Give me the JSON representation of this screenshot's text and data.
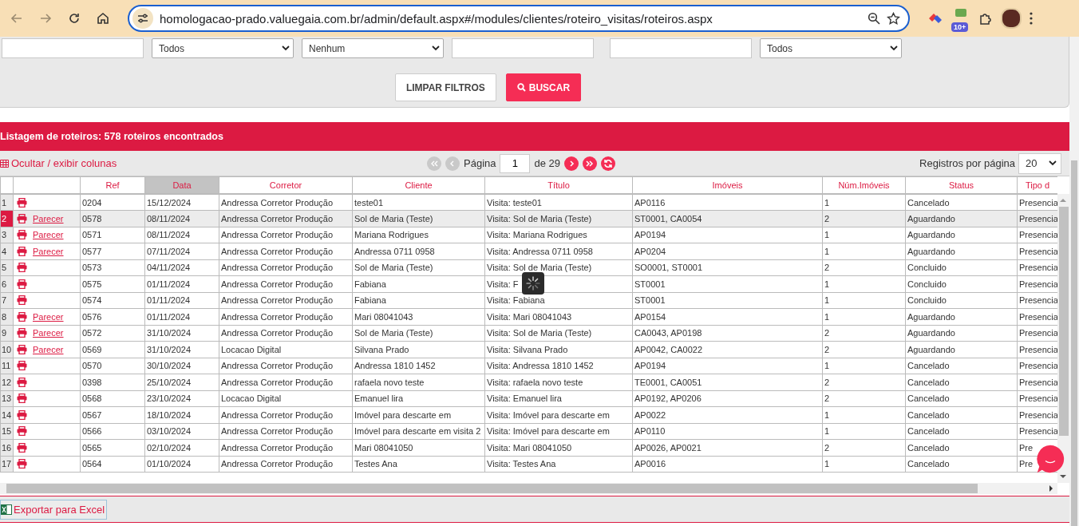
{
  "browser": {
    "url": "homologacao-prado.valuegaia.com.br/admin/default.aspx#/modules/clientes/roteiro_visitas/roteiros.aspx",
    "badge": "10+"
  },
  "filters": [
    {
      "kind": "input"
    },
    {
      "kind": "select",
      "value": "Todos"
    },
    {
      "kind": "select",
      "value": "Nenhum"
    },
    {
      "kind": "input"
    },
    {
      "kind": "input"
    },
    {
      "kind": "select",
      "value": "Todos"
    }
  ],
  "buttons": [
    {
      "kind": "secondary",
      "label": "LIMPAR FILTROS"
    },
    {
      "kind": "primary",
      "label": "BUSCAR"
    }
  ],
  "listing_title": "Listagem de roteiros: 578 roteiros encontrados",
  "toolbar": {
    "columns_toggle": "Ocultar / exibir colunas",
    "page_label": "Página",
    "page": "1",
    "page_total": "de 29",
    "per_page_label": "Registros por página",
    "per_page": "20"
  },
  "table": {
    "columns": [
      {
        "label": "Ref",
        "sorted": false
      },
      {
        "label": "Data",
        "sorted": true
      },
      {
        "label": "Corretor",
        "sorted": false
      },
      {
        "label": "Cliente",
        "sorted": false
      },
      {
        "label": "Título",
        "sorted": false
      },
      {
        "label": "Imóveis",
        "sorted": false
      },
      {
        "label": "Núm.Imóveis",
        "sorted": false
      },
      {
        "label": "Status",
        "sorted": false
      },
      {
        "label": "Tipo d",
        "sorted": false
      }
    ],
    "rows": [
      {
        "num": "1",
        "selected": false,
        "cells": [
          "0204",
          "15/12/2024",
          "Andressa Corretor Produção",
          "teste01",
          "Visita: teste01",
          "AP0116",
          "1",
          "Cancelado",
          "Presencia"
        ]
      },
      {
        "num": "2",
        "selected": true,
        "link": "Parecer",
        "cells": [
          "0578",
          "08/11/2024",
          "Andressa Corretor Produção",
          "Sol de Maria (Teste)",
          "Visita: Sol de Maria (Teste)",
          "ST0001, CA0054",
          "2",
          "Aguardando",
          "Presencia"
        ]
      },
      {
        "num": "3",
        "selected": false,
        "link": "Parecer",
        "cells": [
          "0571",
          "08/11/2024",
          "Andressa Corretor Produção",
          "Mariana Rodrigues",
          "Visita: Mariana Rodrigues",
          "AP0194",
          "1",
          "Aguardando",
          "Presencia"
        ]
      },
      {
        "num": "4",
        "selected": false,
        "link": "Parecer",
        "cells": [
          "0577",
          "07/11/2024",
          "Andressa Corretor Produção",
          "Andressa 0711 0958",
          "Visita: Andressa 0711 0958",
          "AP0204",
          "1",
          "Aguardando",
          "Presencia"
        ]
      },
      {
        "num": "5",
        "selected": false,
        "cells": [
          "0573",
          "04/11/2024",
          "Andressa Corretor Produção",
          "Sol de Maria (Teste)",
          "Visita: Sol de Maria (Teste)",
          "SO0001, ST0001",
          "2",
          "Concluido",
          "Presencia"
        ]
      },
      {
        "num": "6",
        "selected": false,
        "cells": [
          "0575",
          "01/11/2024",
          "Andressa Corretor Produção",
          "Fabiana",
          "Visita: F",
          "ST0001",
          "1",
          "Concluido",
          "Presencia"
        ]
      },
      {
        "num": "7",
        "selected": false,
        "cells": [
          "0574",
          "01/11/2024",
          "Andressa Corretor Produção",
          "Fabiana",
          "Visita: Fabiana",
          "ST0001",
          "1",
          "Concluido",
          "Presencia"
        ]
      },
      {
        "num": "8",
        "selected": false,
        "link": "Parecer",
        "cells": [
          "0576",
          "01/11/2024",
          "Andressa Corretor Produção",
          "Mari 08041043",
          "Visita: Mari 08041043",
          "AP0154",
          "1",
          "Aguardando",
          "Presencia"
        ]
      },
      {
        "num": "9",
        "selected": false,
        "link": "Parecer",
        "cells": [
          "0572",
          "31/10/2024",
          "Andressa Corretor Produção",
          "Sol de Maria (Teste)",
          "Visita: Sol de Maria (Teste)",
          "CA0043, AP0198",
          "2",
          "Aguardando",
          "Presencia"
        ]
      },
      {
        "num": "10",
        "selected": false,
        "link": "Parecer",
        "cells": [
          "0569",
          "31/10/2024",
          "Locacao Digital",
          "Silvana Prado",
          "Visita: Silvana Prado",
          "AP0042, CA0022",
          "2",
          "Aguardando",
          "Presencia"
        ]
      },
      {
        "num": "11",
        "selected": false,
        "cells": [
          "0570",
          "30/10/2024",
          "Andressa Corretor Produção",
          "Andressa 1810 1452",
          "Visita: Andressa 1810 1452",
          "AP0194",
          "1",
          "Cancelado",
          "Presencia"
        ]
      },
      {
        "num": "12",
        "selected": false,
        "cells": [
          "0398",
          "25/10/2024",
          "Andressa Corretor Produção",
          "rafaela novo teste",
          "Visita: rafaela novo teste",
          "TE0001, CA0051",
          "2",
          "Cancelado",
          "Presencia"
        ]
      },
      {
        "num": "13",
        "selected": false,
        "cells": [
          "0568",
          "23/10/2024",
          "Locacao Digital",
          "Emanuel lira",
          "Visita: Emanuel lira",
          "AP0192, AP0206",
          "2",
          "Cancelado",
          "Presencia"
        ]
      },
      {
        "num": "14",
        "selected": false,
        "cells": [
          "0567",
          "18/10/2024",
          "Andressa Corretor Produção",
          "Imóvel para descarte em",
          "Visita: Imóvel para descarte em",
          "AP0022",
          "1",
          "Cancelado",
          "Presencia"
        ]
      },
      {
        "num": "15",
        "selected": false,
        "cells": [
          "0566",
          "03/10/2024",
          "Andressa Corretor Produção",
          "Imóvel para descarte em visita 2",
          "Visita: Imóvel para descarte em",
          "AP0110",
          "1",
          "Cancelado",
          "Presencia"
        ]
      },
      {
        "num": "16",
        "selected": false,
        "cells": [
          "0565",
          "02/10/2024",
          "Andressa Corretor Produção",
          "Mari 08041050",
          "Visita: Mari 08041050",
          "AP0026, AP0021",
          "2",
          "Cancelado",
          "Pre"
        ]
      },
      {
        "num": "17",
        "selected": false,
        "cells": [
          "0564",
          "01/10/2024",
          "Andressa Corretor Produção",
          "Testes Ana",
          "Visita: Testes Ana",
          "AP0016",
          "1",
          "Cancelado",
          "Pre"
        ]
      }
    ]
  },
  "export_label": "Exportar para Excel"
}
